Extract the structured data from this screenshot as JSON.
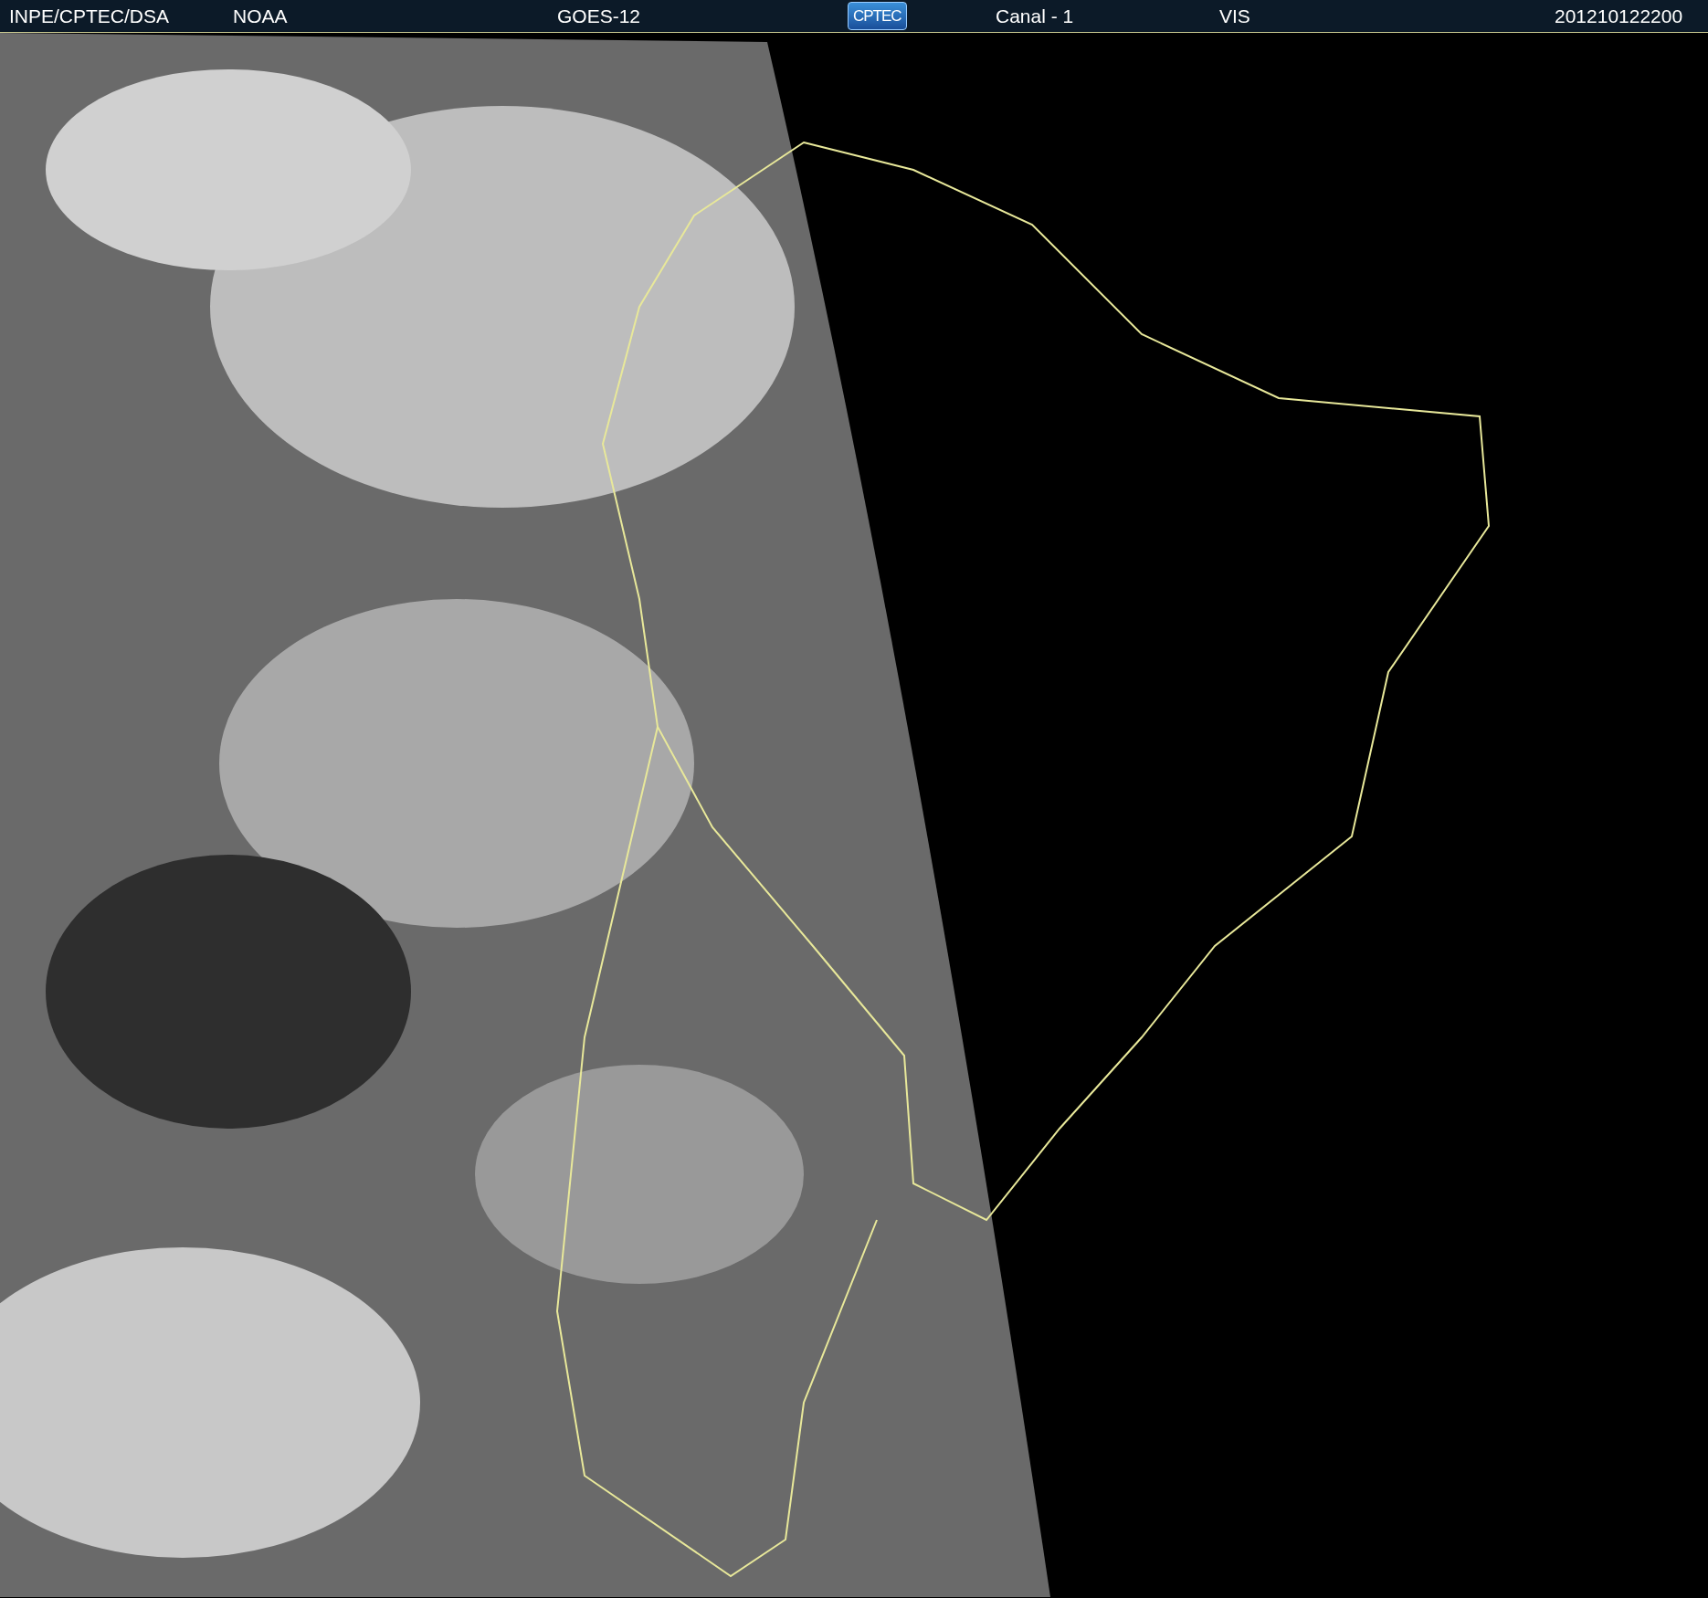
{
  "header": {
    "items": [
      {
        "kind": "text",
        "text": "INPE/CPTEC/DSA"
      },
      {
        "kind": "text",
        "text": "NOAA"
      },
      {
        "kind": "text",
        "text": "GOES-12"
      },
      {
        "kind": "logo",
        "text": "CPTEC"
      },
      {
        "kind": "text",
        "text": "Canal - 1"
      },
      {
        "kind": "text",
        "text": "VIS"
      },
      {
        "kind": "text",
        "text": "201210122200"
      }
    ]
  }
}
